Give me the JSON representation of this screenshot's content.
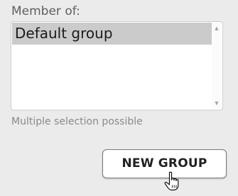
{
  "group_selector": {
    "label": "Member of:",
    "options": [
      "Default group"
    ],
    "selected_option": "Default group",
    "hint": "Multiple selection possible"
  },
  "actions": {
    "new_group_label": "NEW GROUP"
  },
  "icons": {
    "scroll_up": "scroll-up-arrow-icon",
    "scroll_down": "scroll-down-arrow-icon",
    "cursor": "hand-pointer-cursor-icon"
  },
  "colors": {
    "background": "#ebebeb",
    "selected_row": "#cbcbcb",
    "button_border": "#7a7a7a"
  }
}
